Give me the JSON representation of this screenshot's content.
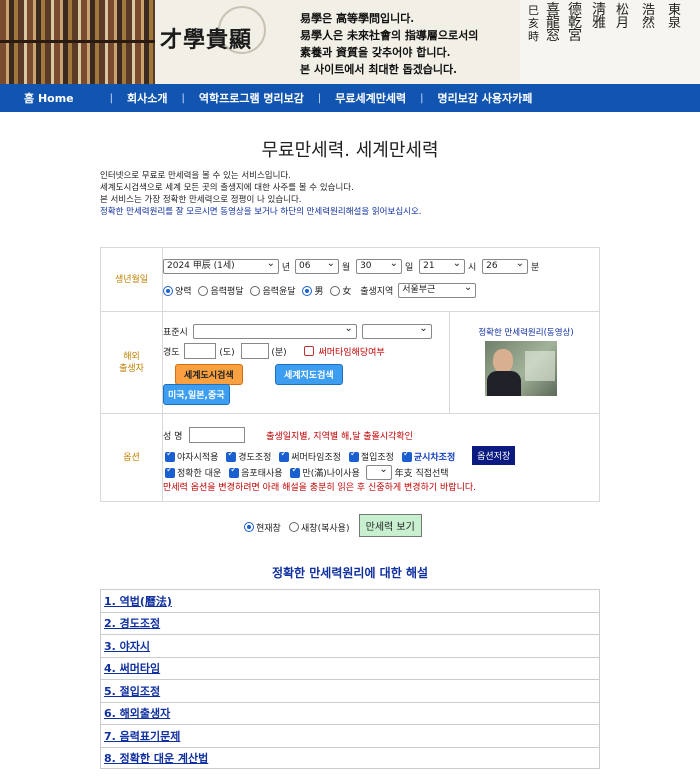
{
  "banner": {
    "logo": "才學貴顯",
    "slogan": [
      "易學은 高等學問입니다.",
      "易學人은 未來社會의 指導層으로서의",
      "素養과 資質을 갖추어야 합니다.",
      "본 사이트에서 최대한 돕겠습니다."
    ]
  },
  "nav": {
    "items": [
      {
        "label": "홈 Home"
      },
      {
        "label": "회사소개"
      },
      {
        "label": "역학프로그램 명리보감"
      },
      {
        "label": "무료세계만세력"
      },
      {
        "label": "명리보감 사용자카페"
      }
    ]
  },
  "page": {
    "title": "무료만세력. 세계만세력",
    "intro": [
      "인터넷으로 무료로 만세력을 볼 수 있는 서비스입니다.",
      "세계도시검색으로 세계 모든 곳의 출생지에 대한 사주를 볼 수 있습니다.",
      "본 서비스는 가장 정확한 만세력으로 정평이 나 있습니다."
    ],
    "intro_link": "정확한 만세력원리를 잘 모르시면 동영상을 보거나 하단의 만세력원리해설을 읽어보십시오."
  },
  "birth": {
    "label": "생년월일",
    "year": "2024 甲辰 (1세)",
    "year_unit": "년",
    "month": "06",
    "month_unit": "월",
    "day": "30",
    "day_unit": "일",
    "hour": "21",
    "hour_unit": "시",
    "minute": "26",
    "minute_unit": "분",
    "calendar_options": [
      "양력",
      "음력평달",
      "음력윤달"
    ],
    "gender_options": [
      "男",
      "女"
    ],
    "region_label": "출생지역",
    "region_value": "서울부근"
  },
  "overseas": {
    "label": [
      "해외",
      "출생자"
    ],
    "timezone_label": "표준시",
    "longitude_label": "경도",
    "degree_unit": "(도)",
    "minute_unit": "(분)",
    "summer_time_label": "써머타임해당여부",
    "city_search_button": "세계도시검색",
    "map_search_button": "세계지도검색",
    "regions_button": "미국,일본,중국",
    "video_title": "정확한 만세력원리(동영상)"
  },
  "options": {
    "label": "옵션",
    "name_label": "성 명",
    "name_note": "출생일지별, 지역별 해,달 출몰시각확인",
    "checks_row1": [
      "야자시적용",
      "경도조정",
      "써머타임조정",
      "절입조정"
    ],
    "checks_row1_strong": "균시차조정",
    "save_button": "옵션저장",
    "checks_row2": [
      "정확한 대운",
      "음포태사용",
      "만(滿)나이사용"
    ],
    "yearpillar_label": "年支 직접선택",
    "warning": "만세력 옵션을 변경하려면 아래 해설을 충분히 읽은 후 신중하게 변경하기 바랍니다."
  },
  "view": {
    "options": [
      "현재창",
      "새창(복사용)"
    ],
    "button": "만세력 보기"
  },
  "explain": {
    "title": "정확한 만세력원리에 대한 해설",
    "items": [
      "1. 역법(曆法)",
      "2. 경도조정",
      "3. 야자시",
      "4. 써머타임",
      "5. 절입조정",
      "6. 해외출생자",
      "7. 음력표기문제",
      "8. 정확한 대운 계산법"
    ]
  },
  "colors": {
    "nav_bg": "#1155b0",
    "label_text": "#c08000",
    "link_blue": "#1030a0",
    "accent_blue": "#1a5fd0"
  }
}
